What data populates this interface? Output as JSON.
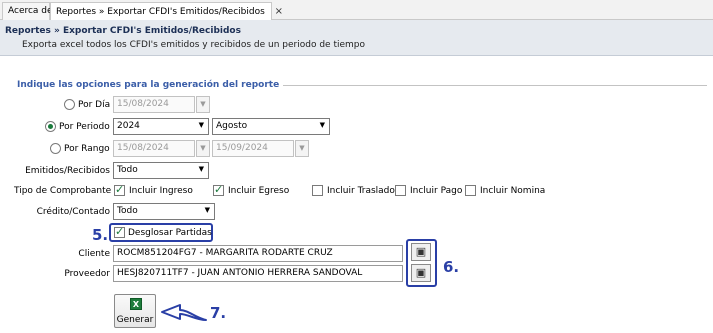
{
  "tabs": [
    {
      "label": "Acerca de"
    },
    {
      "label": "Reportes » Exportar CFDI's Emitidos/Recibidos",
      "close": "×"
    }
  ],
  "header": {
    "title": "Reportes » Exportar CFDI's Emitidos/Recibidos",
    "description": "Exporta excel todos los CFDI's emitidos y recibidos de un periodo de tiempo"
  },
  "form": {
    "legend": "Indique las opciones para la generación del reporte",
    "por_dia": {
      "label": "Por Día",
      "date": "15/08/2024",
      "selected": false
    },
    "por_periodo": {
      "label": "Por Periodo",
      "year": "2024",
      "month": "Agosto",
      "selected": true
    },
    "por_rango": {
      "label": "Por Rango",
      "from": "15/08/2024",
      "to": "15/09/2024",
      "selected": false
    },
    "emitidos": {
      "label": "Emitidos/Recibidos",
      "value": "Todo"
    },
    "tipo": {
      "label": "Tipo de Comprobante",
      "options": [
        {
          "label": "Incluir Ingreso",
          "checked": true
        },
        {
          "label": "Incluir Egreso",
          "checked": true
        },
        {
          "label": "Incluir Traslado",
          "checked": false
        },
        {
          "label": "Incluir Pago",
          "checked": false
        },
        {
          "label": "Incluir Nomina",
          "checked": false
        }
      ]
    },
    "credito": {
      "label": "Crédito/Contado",
      "value": "Todo"
    },
    "desglosar": {
      "label": "Desglosar Partidas",
      "checked": true
    },
    "cliente": {
      "label": "Cliente",
      "value": "ROCM851204FG7 - MARGARITA RODARTE CRUZ"
    },
    "proveedor": {
      "label": "Proveedor",
      "value": "HESJ820711TF7 - JUAN ANTONIO HERRERA SANDOVAL"
    },
    "generar": {
      "label": "Generar",
      "icon": "excel-icon"
    }
  },
  "annotations": {
    "step5": "5.",
    "step6": "6.",
    "step7": "7."
  },
  "colors": {
    "callout": "#2a3fa6",
    "legend": "#3b5ea8",
    "check": "#1a7a3c"
  }
}
